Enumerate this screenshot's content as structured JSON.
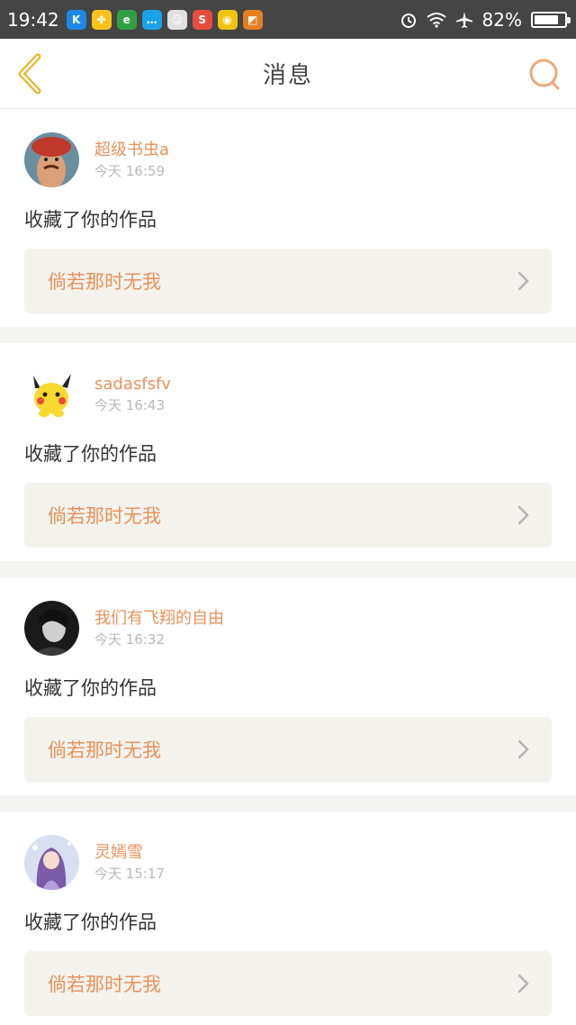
{
  "status_bar": {
    "time": "19:42",
    "battery_percent": "82%",
    "battery_level": 0.82,
    "app_icons": [
      {
        "name": "k-app-icon",
        "color": "#1e88e5",
        "glyph": "K"
      },
      {
        "name": "clover-app-icon",
        "color": "#f9c31a",
        "glyph": "✤"
      },
      {
        "name": "browser-e-app-icon",
        "color": "#2ea043",
        "glyph": "e"
      },
      {
        "name": "qq-chat-app-icon",
        "color": "#1aa3e8",
        "glyph": "…"
      },
      {
        "name": "face-app-icon",
        "color": "#e0e0e0",
        "glyph": "☺"
      },
      {
        "name": "s-app-icon",
        "color": "#e74c3c",
        "glyph": "S"
      },
      {
        "name": "panda-app-icon",
        "color": "#f1c40f",
        "glyph": "◉"
      },
      {
        "name": "stripes-app-icon",
        "color": "#e67e22",
        "glyph": "◩"
      }
    ]
  },
  "nav": {
    "title": "消息"
  },
  "messages": [
    {
      "username": "超级书虫a",
      "time": "今天 16:59",
      "action": "收藏了你的作品",
      "work_title": "倘若那时无我",
      "avatar": "red-hat-man"
    },
    {
      "username": "sadasfsfv",
      "time": "今天 16:43",
      "action": "收藏了你的作品",
      "work_title": "倘若那时无我",
      "avatar": "pikachu"
    },
    {
      "username": "我们有飞翔的自由",
      "time": "今天 16:32",
      "action": "收藏了你的作品",
      "work_title": "倘若那时无我",
      "avatar": "dark-portrait"
    },
    {
      "username": "灵嫣雪",
      "time": "今天 15:17",
      "action": "收藏了你的作品",
      "work_title": "倘若那时无我",
      "avatar": "anime-girl"
    }
  ],
  "colors": {
    "accent": "#e8925a",
    "back_icon": "#e5b82a",
    "search_icon": "#f0a878"
  }
}
